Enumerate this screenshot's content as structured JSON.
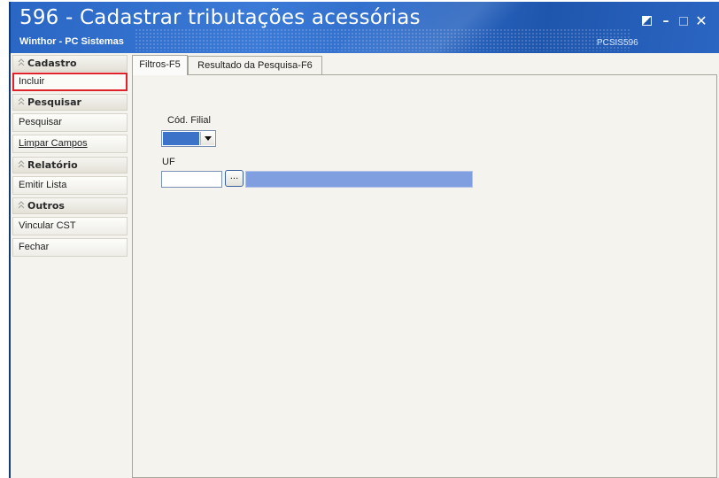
{
  "window": {
    "title": "596 - Cadastrar tributações acessórias",
    "subtitle": "Winthor - PC Sistemas",
    "module_code": "PCSIS596",
    "controls": {
      "restore_icon": "restore-icon",
      "minimize_glyph": "–",
      "maximize_icon": "maximize-icon",
      "close_glyph": "✕"
    }
  },
  "sidebar": {
    "sections": [
      {
        "title": "Cadastro",
        "items": [
          {
            "label": "Incluir",
            "selected": true
          }
        ]
      },
      {
        "title": "Pesquisar",
        "items": [
          {
            "label": "Pesquisar"
          },
          {
            "label": "Limpar Campos"
          }
        ]
      },
      {
        "title": "Relatório",
        "items": [
          {
            "label": "Emitir Lista"
          }
        ]
      },
      {
        "title": "Outros",
        "items": [
          {
            "label": "Vincular CST"
          },
          {
            "label": "Fechar"
          }
        ]
      }
    ],
    "highlight_color": "#e0222a"
  },
  "tabs": [
    {
      "label": "Filtros-F5",
      "active": true
    },
    {
      "label": "Resultado da Pesquisa-F6",
      "active": false
    }
  ],
  "filters": {
    "cod_filial": {
      "label": "Cód. Filial",
      "value": ""
    },
    "uf": {
      "label": "UF",
      "value": "",
      "button_label": "...",
      "description": ""
    }
  },
  "colors": {
    "title_bar": "#2a66c4",
    "selection_blue": "#3d72c9",
    "description_fill": "#7f9fe0"
  }
}
